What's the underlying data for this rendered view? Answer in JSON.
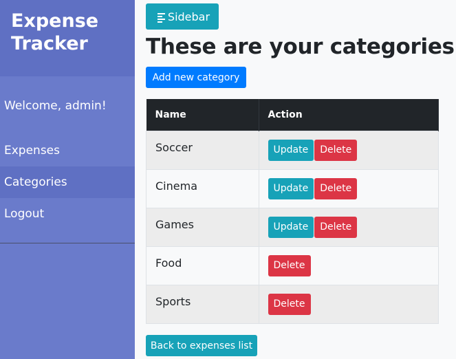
{
  "sidebar": {
    "brand": "Expense Tracker",
    "welcome": "Welcome, admin!",
    "items": [
      {
        "label": "Expenses"
      },
      {
        "label": "Categories"
      },
      {
        "label": "Logout"
      }
    ]
  },
  "toolbar": {
    "toggle_label": "Sidebar"
  },
  "main": {
    "title": "These are your categories:",
    "add_label": "Add new category",
    "back_label": "Back to expenses list"
  },
  "table": {
    "headers": [
      "Name",
      "Action"
    ],
    "rows": [
      {
        "name": "Soccer",
        "update": "Update",
        "delete": "Delete"
      },
      {
        "name": "Cinema",
        "update": "Update",
        "delete": "Delete"
      },
      {
        "name": "Games",
        "update": "Update",
        "delete": "Delete"
      },
      {
        "name": "Food",
        "delete": "Delete"
      },
      {
        "name": "Sports",
        "delete": "Delete"
      }
    ]
  },
  "colors": {
    "sidebar": "#6a7bcb",
    "sidebar_header": "#5f70c3",
    "teal": "#17a2b8",
    "primary": "#007bff",
    "danger": "#dc3545",
    "dark": "#212529"
  }
}
